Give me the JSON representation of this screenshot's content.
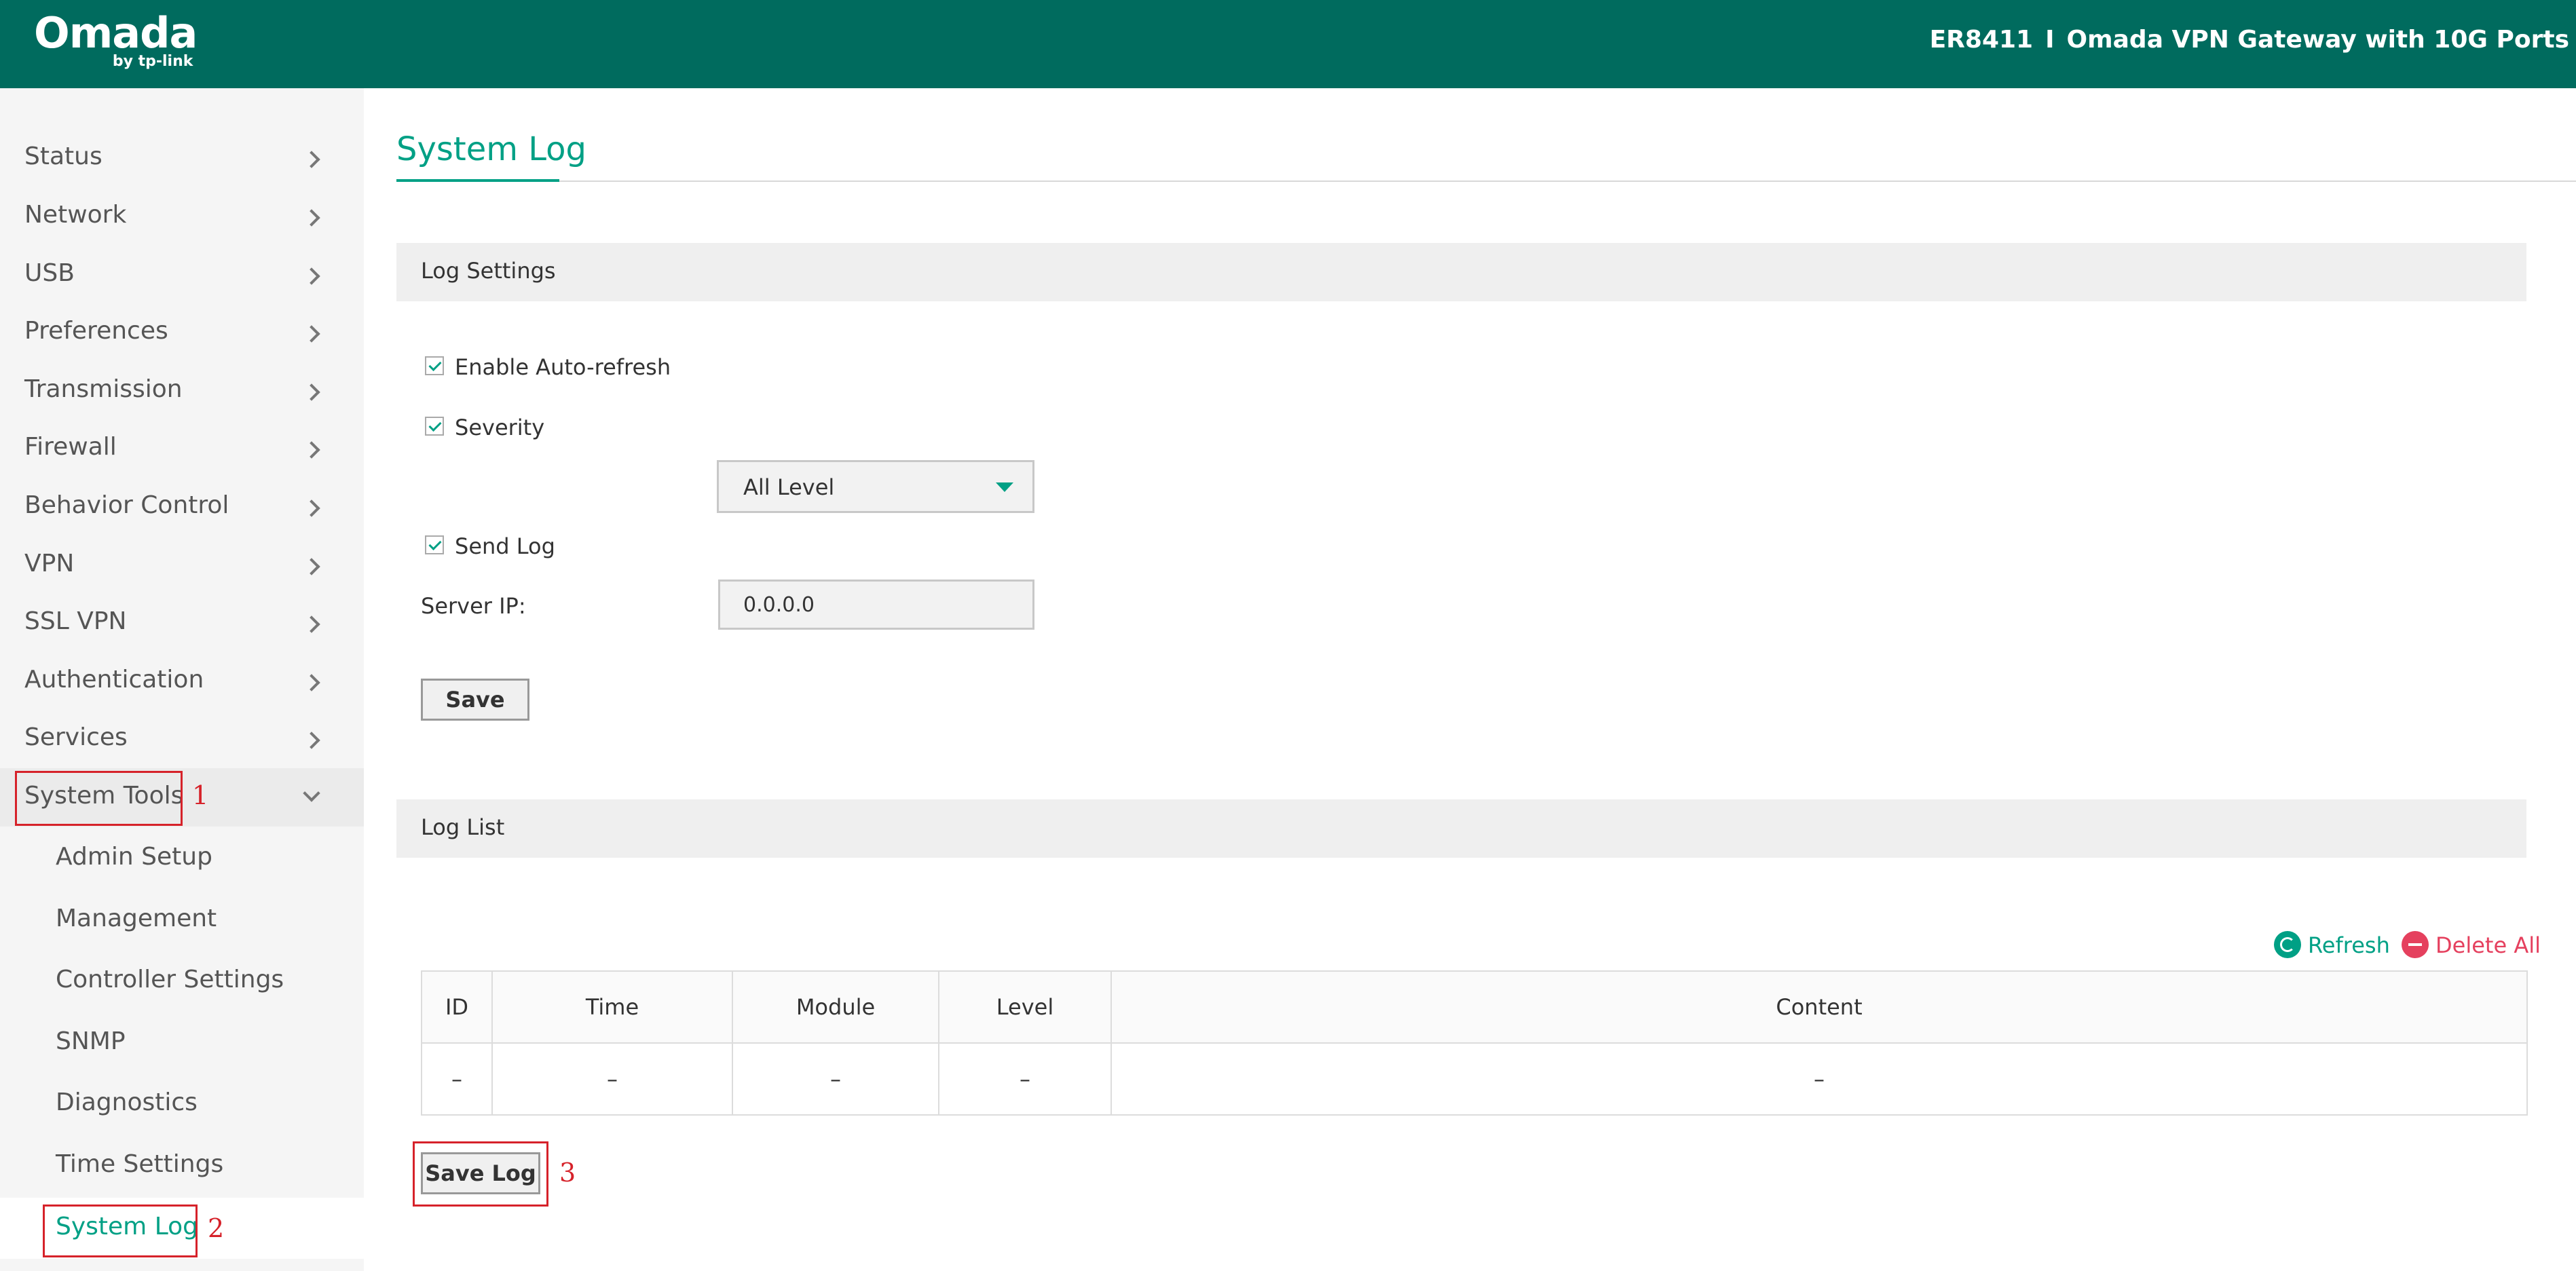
{
  "header": {
    "logo_main": "Omada",
    "logo_sub": "by tp-link",
    "model": "ER8411",
    "separator": "I",
    "product": "Omada VPN Gateway with 10G Ports"
  },
  "sidebar": {
    "items": [
      {
        "label": "Status"
      },
      {
        "label": "Network"
      },
      {
        "label": "USB"
      },
      {
        "label": "Preferences"
      },
      {
        "label": "Transmission"
      },
      {
        "label": "Firewall"
      },
      {
        "label": "Behavior Control"
      },
      {
        "label": "VPN"
      },
      {
        "label": "SSL VPN"
      },
      {
        "label": "Authentication"
      },
      {
        "label": "Services"
      },
      {
        "label": "System Tools"
      }
    ],
    "subitems": [
      {
        "label": "Admin Setup"
      },
      {
        "label": "Management"
      },
      {
        "label": "Controller Settings"
      },
      {
        "label": "SNMP"
      },
      {
        "label": "Diagnostics"
      },
      {
        "label": "Time Settings"
      },
      {
        "label": "System Log"
      }
    ]
  },
  "annotations": [
    "1",
    "2",
    "3"
  ],
  "main": {
    "title": "System Log",
    "log_settings": {
      "section_label": "Log Settings",
      "auto_refresh_label": "Enable Auto-refresh",
      "severity_label": "Severity",
      "severity_value": "All Level",
      "send_log_label": "Send Log",
      "server_ip_label": "Server IP:",
      "server_ip_value": "0.0.0.0",
      "save_label": "Save"
    },
    "log_list": {
      "section_label": "Log List",
      "refresh_label": "Refresh",
      "delete_all_label": "Delete All",
      "columns": [
        "ID",
        "Time",
        "Module",
        "Level",
        "Content"
      ],
      "rows": [
        [
          "–",
          "–",
          "–",
          "–",
          "–"
        ]
      ],
      "save_log_label": "Save Log"
    }
  },
  "colors": {
    "header_bg": "#006b5e",
    "accent": "#00a085",
    "danger": "#e5405e",
    "annotation": "#d6222a"
  },
  "icons": {
    "chevron": "chevron-right-icon",
    "expanded_chevron": "chevron-down-icon",
    "refresh": "refresh-icon",
    "delete": "minus-circle-icon",
    "dropdown": "caret-down-icon",
    "checkbox": "checkbox-checked-icon"
  }
}
